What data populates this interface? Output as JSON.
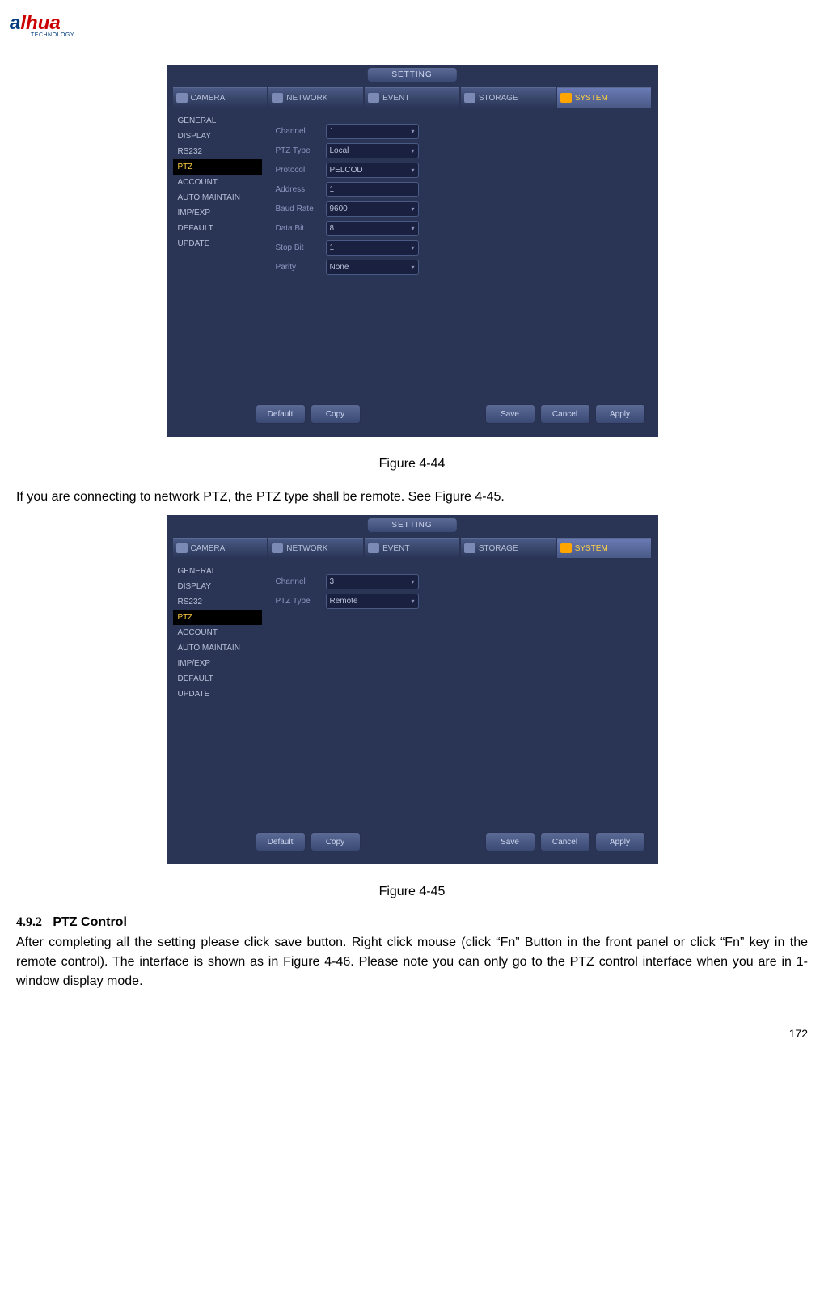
{
  "logo": {
    "text1": "a",
    "text2": "lhua",
    "sub": "TECHNOLOGY"
  },
  "fig1": {
    "title": "SETTING",
    "tabs": [
      "CAMERA",
      "NETWORK",
      "EVENT",
      "STORAGE",
      "SYSTEM"
    ],
    "sidebar": [
      "GENERAL",
      "DISPLAY",
      "RS232",
      "PTZ",
      "ACCOUNT",
      "AUTO MAINTAIN",
      "IMP/EXP",
      "DEFAULT",
      "UPDATE"
    ],
    "sidebar_active": "PTZ",
    "fields": [
      {
        "label": "Channel",
        "value": "1",
        "dropdown": true
      },
      {
        "label": "PTZ Type",
        "value": "Local",
        "dropdown": true
      },
      {
        "label": "Protocol",
        "value": "PELCOD",
        "dropdown": true
      },
      {
        "label": "Address",
        "value": "1",
        "dropdown": false
      },
      {
        "label": "Baud Rate",
        "value": "9600",
        "dropdown": true
      },
      {
        "label": "Data Bit",
        "value": "8",
        "dropdown": true
      },
      {
        "label": "Stop Bit",
        "value": "1",
        "dropdown": true
      },
      {
        "label": "Parity",
        "value": "None",
        "dropdown": true
      }
    ],
    "buttons": {
      "default": "Default",
      "copy": "Copy",
      "save": "Save",
      "cancel": "Cancel",
      "apply": "Apply"
    }
  },
  "caption1": "Figure 4-44",
  "para1": "If you are connecting to network PTZ, the PTZ type shall be remote. See Figure 4-45.",
  "fig2": {
    "title": "SETTING",
    "tabs": [
      "CAMERA",
      "NETWORK",
      "EVENT",
      "STORAGE",
      "SYSTEM"
    ],
    "sidebar": [
      "GENERAL",
      "DISPLAY",
      "RS232",
      "PTZ",
      "ACCOUNT",
      "AUTO MAINTAIN",
      "IMP/EXP",
      "DEFAULT",
      "UPDATE"
    ],
    "sidebar_active": "PTZ",
    "fields": [
      {
        "label": "Channel",
        "value": "3",
        "dropdown": true
      },
      {
        "label": "PTZ Type",
        "value": "Remote",
        "dropdown": true
      }
    ],
    "buttons": {
      "default": "Default",
      "copy": "Copy",
      "save": "Save",
      "cancel": "Cancel",
      "apply": "Apply"
    }
  },
  "caption2": "Figure 4-45",
  "heading_num": "4.9.2",
  "heading_text": "PTZ Control",
  "para2": "After completing all the setting please click save button. Right click mouse (click “Fn” Button in the front panel or click “Fn” key in the remote control). The interface is shown as in Figure 4-46. Please note you can only go to the PTZ control interface when you are in 1-window display mode.",
  "page_number": "172"
}
